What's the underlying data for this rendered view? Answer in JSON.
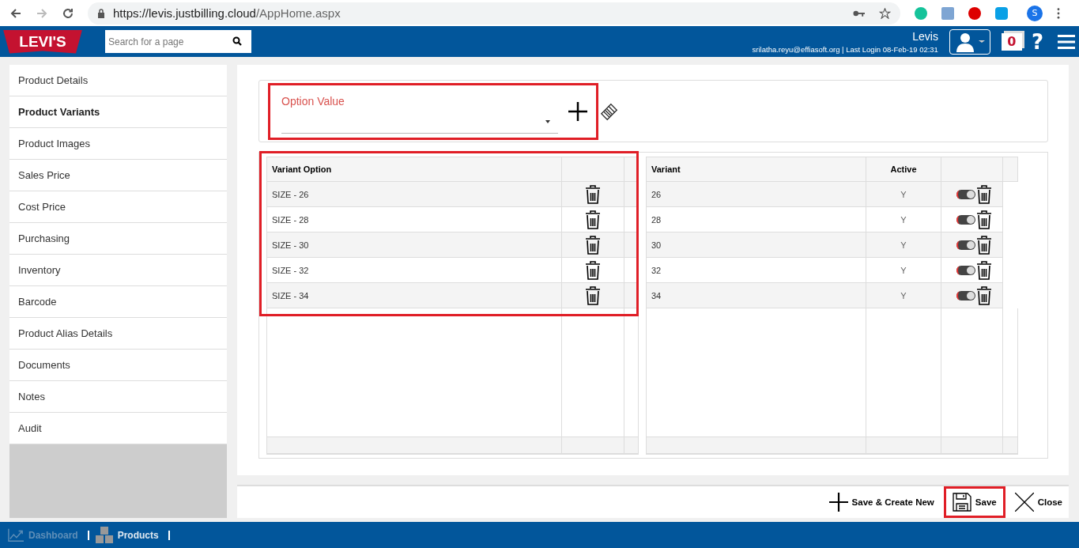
{
  "browser": {
    "url_host": "https://levis.justbilling.cloud",
    "url_path": "/AppHome.aspx",
    "profile_initial": "S"
  },
  "header": {
    "logo": "LEVI'S",
    "search": {
      "placeholder": "Search for a page"
    },
    "company": "Levis",
    "user_line": "srilatha.reyu@effiasoft.org | Last Login 08-Feb-19 02:31",
    "notification_count": "0",
    "help": "?"
  },
  "sidebar": {
    "items": [
      {
        "label": "Product Details",
        "selected": false
      },
      {
        "label": "Product Variants",
        "selected": true
      },
      {
        "label": "Product Images",
        "selected": false
      },
      {
        "label": "Sales Price",
        "selected": false
      },
      {
        "label": "Cost Price",
        "selected": false
      },
      {
        "label": "Purchasing",
        "selected": false
      },
      {
        "label": "Inventory",
        "selected": false
      },
      {
        "label": "Barcode",
        "selected": false
      },
      {
        "label": "Product Alias Details",
        "selected": false
      },
      {
        "label": "Documents",
        "selected": false
      },
      {
        "label": "Notes",
        "selected": false
      },
      {
        "label": "Audit",
        "selected": false
      }
    ]
  },
  "option_value": {
    "label": "Option Value"
  },
  "variant_options": {
    "columns": [
      "Variant Option"
    ],
    "rows": [
      "SIZE - 26",
      "SIZE - 28",
      "SIZE - 30",
      "SIZE - 32",
      "SIZE - 34"
    ]
  },
  "variants": {
    "columns": [
      "Variant",
      "Active"
    ],
    "rows": [
      {
        "variant": "26",
        "active": "Y",
        "on": true
      },
      {
        "variant": "28",
        "active": "Y",
        "on": true
      },
      {
        "variant": "30",
        "active": "Y",
        "on": true
      },
      {
        "variant": "32",
        "active": "Y",
        "on": true
      },
      {
        "variant": "34",
        "active": "Y",
        "on": true
      }
    ]
  },
  "actions": [
    "Save & Create New",
    "Save",
    "Close"
  ],
  "taskbar": [
    {
      "label": "Dashboard",
      "selected": false
    },
    {
      "label": "Products",
      "selected": true
    }
  ]
}
